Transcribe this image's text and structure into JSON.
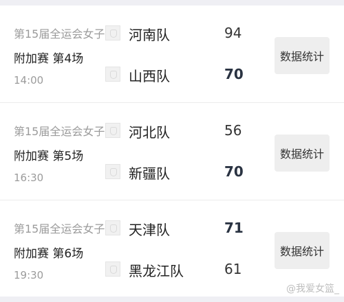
{
  "matches": [
    {
      "league": "第15届全运会女子...",
      "round": "附加赛 第4场",
      "time": "14:00",
      "team1": {
        "name": "河南队",
        "score": "94"
      },
      "team2": {
        "name": "山西队",
        "score": "70"
      },
      "stats_label": "数据统计"
    },
    {
      "league": "第15届全运会女子...",
      "round": "附加赛 第5场",
      "time": "16:30",
      "team1": {
        "name": "河北队",
        "score": "56"
      },
      "team2": {
        "name": "新疆队",
        "score": "70"
      },
      "stats_label": "数据统计"
    },
    {
      "league": "第15届全运会女子...",
      "round": "附加赛 第6场",
      "time": "19:30",
      "team1": {
        "name": "天津队",
        "score": "71"
      },
      "team2": {
        "name": "黑龙江队",
        "score": "61"
      },
      "stats_label": "数据统计"
    }
  ],
  "watermark": "@我爱女篮_",
  "colors": {
    "background": "#efeff4",
    "card": "#ffffff",
    "button": "#eeeeee",
    "winner_score": "#2a3342"
  }
}
